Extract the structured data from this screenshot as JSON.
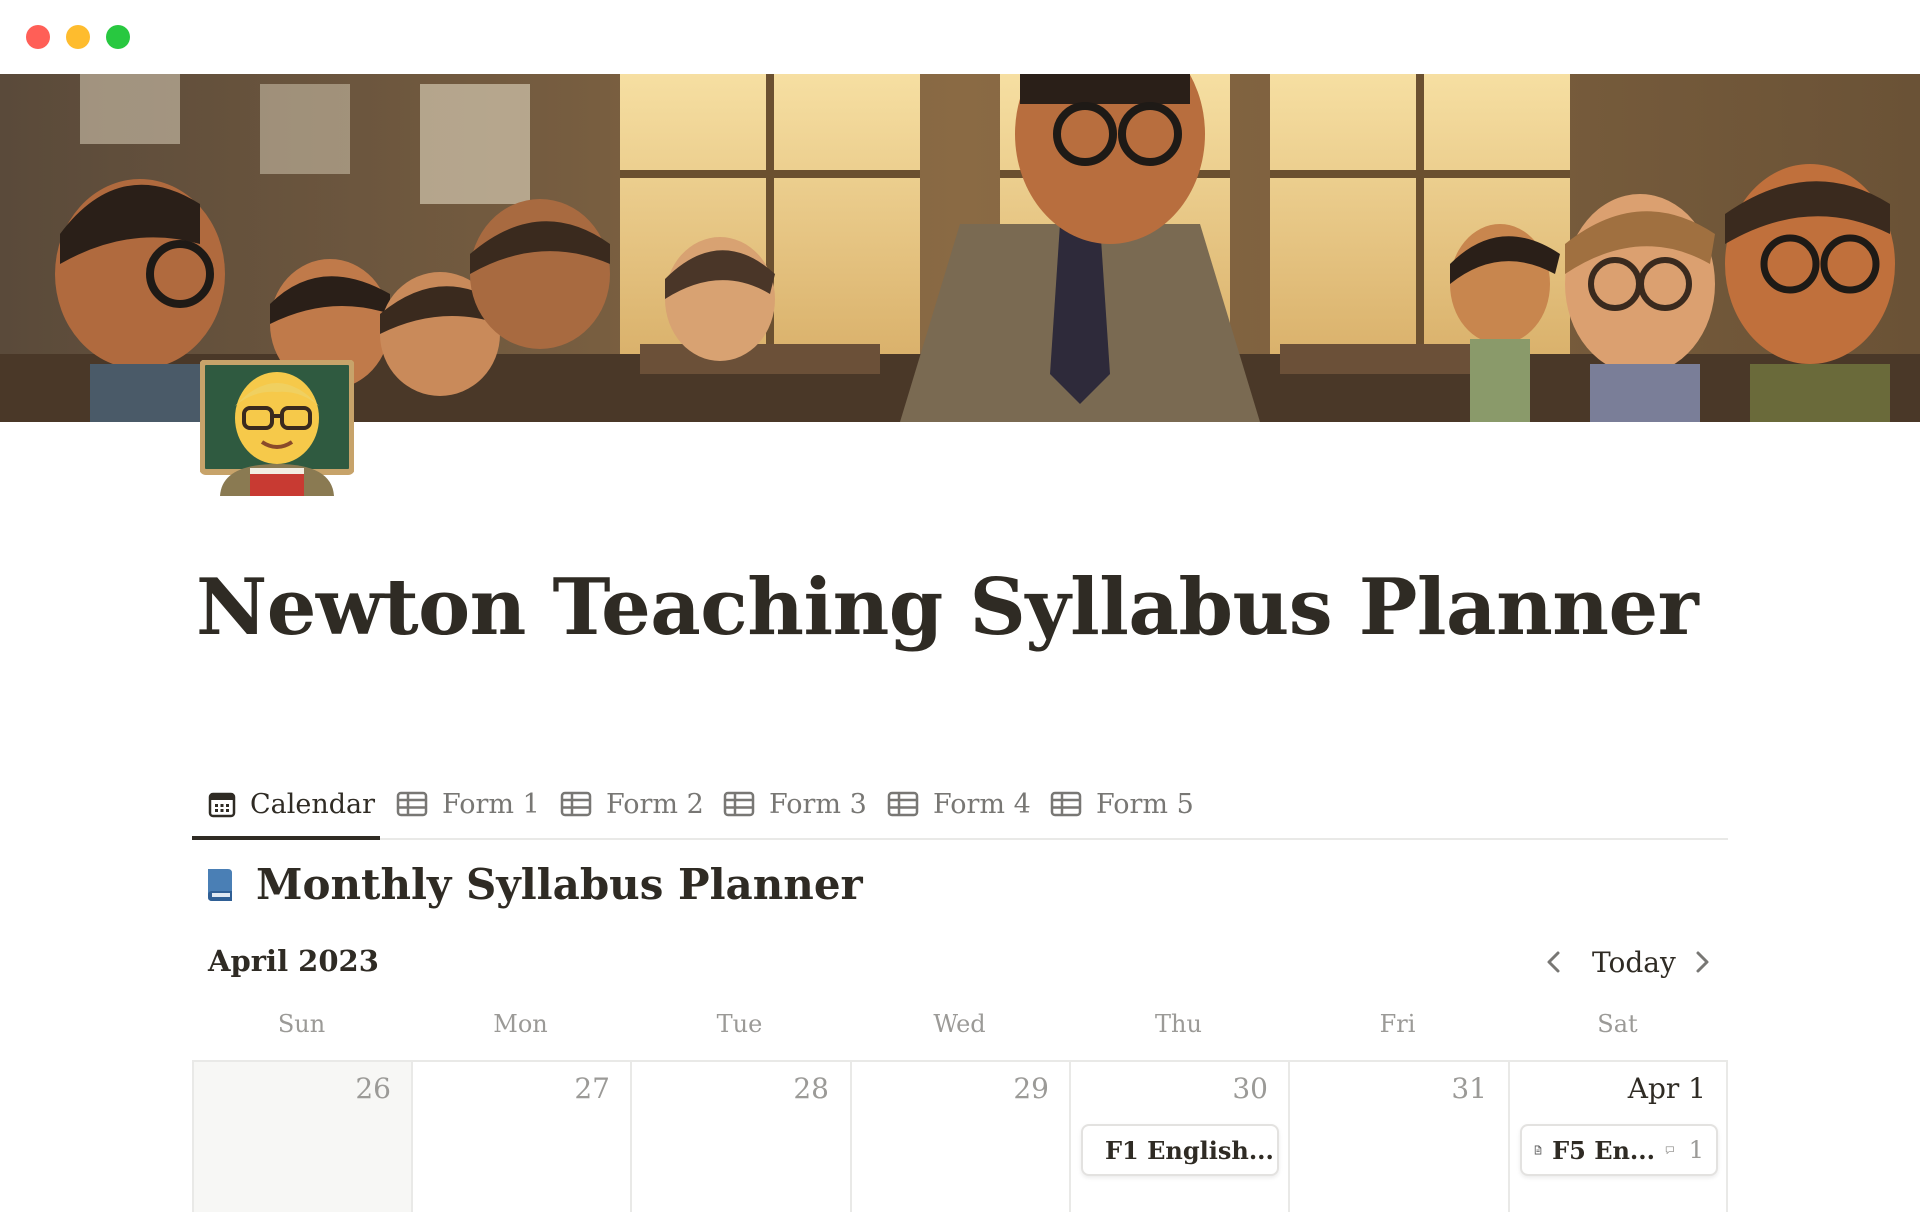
{
  "window": {
    "controls": [
      "close",
      "minimize",
      "maximize"
    ]
  },
  "cover": {
    "description_icon": "classroom-illustration"
  },
  "page": {
    "icon": "teacher-emoji-icon",
    "title": "Newton Teaching Syllabus Planner"
  },
  "tabs": [
    {
      "label": "Calendar",
      "icon": "calendar-icon",
      "active": true
    },
    {
      "label": "Form 1",
      "icon": "table-icon",
      "active": false
    },
    {
      "label": "Form 2",
      "icon": "table-icon",
      "active": false
    },
    {
      "label": "Form 3",
      "icon": "table-icon",
      "active": false
    },
    {
      "label": "Form 4",
      "icon": "table-icon",
      "active": false
    },
    {
      "label": "Form 5",
      "icon": "table-icon",
      "active": false
    }
  ],
  "view": {
    "title": "Monthly Syllabus Planner",
    "icon": "book-icon"
  },
  "calendar": {
    "month": "April 2023",
    "today_label": "Today",
    "weekdays": [
      "Sun",
      "Mon",
      "Tue",
      "Wed",
      "Thu",
      "Fri",
      "Sat"
    ],
    "days": [
      "26",
      "27",
      "28",
      "29",
      "30",
      "31",
      "Apr 1"
    ],
    "events": {
      "thu": {
        "title": "F1 English...",
        "icon": "page-icon"
      },
      "sat": {
        "title": "F5 En...",
        "icon": "page-icon",
        "comment_icon": "comment-icon",
        "comments": "1"
      }
    }
  },
  "colors": {
    "text": "#2f2b24",
    "muted": "#9b9a97",
    "border": "#e9e9e7",
    "book_blue": "#4a7fb5"
  }
}
